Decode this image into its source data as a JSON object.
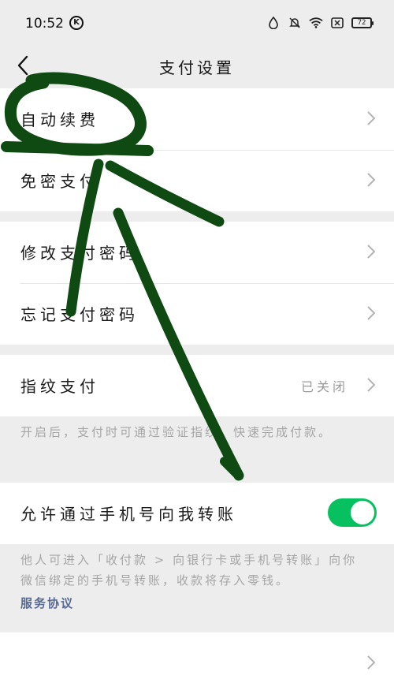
{
  "status_bar": {
    "time": "10:52",
    "battery": "72",
    "icons": [
      "k-app-icon",
      "water-drop-icon",
      "bell-mute-icon",
      "wifi-icon",
      "sim-card-icon",
      "battery-icon"
    ]
  },
  "nav": {
    "title": "支付设置",
    "back_icon": "back-arrow-icon"
  },
  "settings": {
    "auto_renew": "自动续费",
    "password_free": "免密支付",
    "change_password": "修改支付密码",
    "forgot_password": "忘记支付密码",
    "fingerprint": {
      "label": "指纹支付",
      "value": "已关闭"
    },
    "fingerprint_note": "开启后，支付时可通过验证指纹，快速完成付款。",
    "allow_transfer": {
      "label": "允许通过手机号向我转账",
      "enabled": true
    },
    "transfer_note": "他人可进入「收付款 > 向银行卡或手机号转账」向你微信绑定的手机号转账，收款将存入零钱。",
    "service_link": "服务协议",
    "last_row": ""
  },
  "colors": {
    "toggle_on": "#07c160",
    "link": "#576b95",
    "annotation": "#0f4a12",
    "background": "#ededed"
  }
}
